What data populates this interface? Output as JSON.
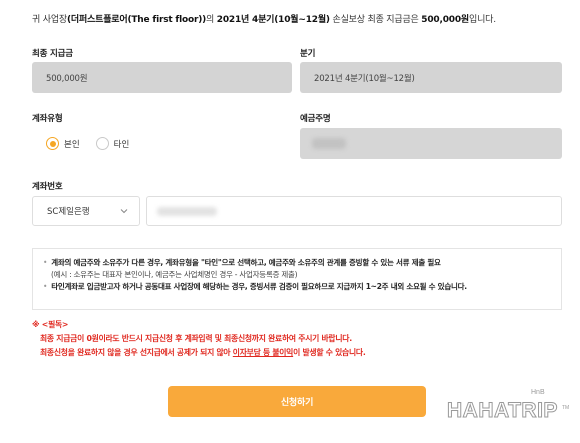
{
  "intro": {
    "prefix": "귀 사업장",
    "business_name": "(더퍼스트플로어(The first floor))",
    "middle": "의 ",
    "period": "2021년 4분기(10월~12월)",
    "middle2": " 손실보상 최종 지급금은 ",
    "amount": "500,000원",
    "suffix": "입니다."
  },
  "fields": {
    "final_payment_label": "최종 지급금",
    "final_payment_value": "500,000원",
    "quarter_label": "분기",
    "quarter_value": "2021년 4분기(10월~12월)",
    "account_type_label": "계좌유형",
    "account_type_options": [
      "본인",
      "타인"
    ],
    "account_type_selected": "본인",
    "depositor_label": "예금주명",
    "account_number_label": "계좌번호",
    "bank_selected": "SC제일은행"
  },
  "notice": {
    "line1": "계좌의 예금주와 소유주가 다른 경우, 계좌유형을 \"타인\"으로 선택하고, 예금주와 소유주의 관계를 증빙할 수 있는 서류 제출 필요",
    "line2": "(예시 : 소유주는 대표자 본인이나, 예금주는 사업체명인 경우 - 사업자등록증 제출)",
    "line3": "타인계좌로 입금받고자 하거나 공동대표 사업장에 해당하는 경우, 증빙서류 검증이 필요하므로 지급까지 1~2주 내외 소요될 수 있습니다."
  },
  "warning": {
    "head": "※ <필독>",
    "line1": "최종 지급금이 0원이라도 반드시 지급신청 후 계좌입력 및 최종신청까지 완료하여 주시기 바랍니다.",
    "line2_pre": "최종신청을 완료하지 않을 경우 선지급에서 공제가 되지 않아 ",
    "line2_under": "이자부담 등 불이익",
    "line2_post": "이 발생할 수 있습니다."
  },
  "submit_label": "신청하기",
  "watermark": {
    "small": "HnB",
    "main": "HAHATRIP",
    "tm": "TM"
  },
  "colors": {
    "accent": "#f9a93b",
    "radio_checked": "#f5a623",
    "warning": "#e0281f",
    "readonly_bg": "#d4d4d4"
  }
}
